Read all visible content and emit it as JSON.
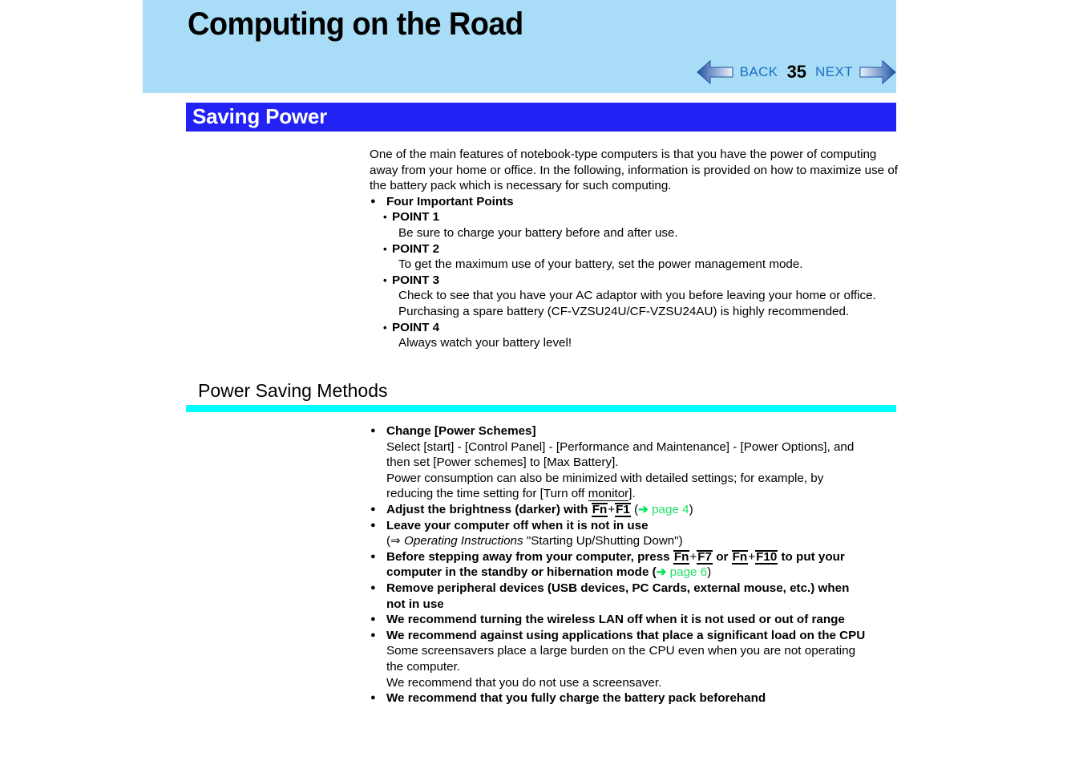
{
  "header": {
    "title": "Computing on the Road",
    "nav": {
      "back_label": "BACK",
      "page_number": "35",
      "next_label": "NEXT",
      "back_icon": "left-arrow-icon",
      "next_icon": "right-arrow-icon"
    },
    "background_color": "#a9ddf7"
  },
  "section": {
    "banner_title": "Saving Power",
    "banner_color": "#2222f5",
    "banner_text_color": "#ffffff"
  },
  "intro": {
    "paragraph": "One of the main features of notebook-type computers is that you have the power of computing away from your home or office.  In the following, information is provided on how to maximize use of the battery pack which is necessary for such computing.",
    "points_heading": "Four Important Points",
    "points": [
      {
        "label": "POINT 1",
        "text": "Be sure to charge your battery before and after use."
      },
      {
        "label": "POINT 2",
        "text": "To get the maximum use of your battery, set the power management mode."
      },
      {
        "label": "POINT 3",
        "text": "Check to see that you have your AC adaptor with you before leaving your home or office.",
        "text2": "Purchasing a spare battery (CF-VZSU24U/CF-VZSU24AU) is highly recommended."
      },
      {
        "label": "POINT 4",
        "text": "Always watch your battery level!"
      }
    ]
  },
  "subsection": {
    "title": "Power Saving Methods",
    "rule_color": "#00ffff"
  },
  "methods": {
    "item1": {
      "heading": "Change [Power Schemes]",
      "line1": "Select [start] - [Control Panel] - [Performance and Maintenance] - [Power Options], and",
      "line2": "then set [Power schemes] to [Max Battery].",
      "line3": "Power consumption can also be minimized with detailed settings; for example, by",
      "line4_pre": "reducing the time setting for [Turn off ",
      "line4_key": "monitor",
      "line4_post": "]."
    },
    "item2": {
      "heading_pre": "Adjust the brightness (darker) with ",
      "key1": "Fn",
      "plus": "+",
      "key2": "F1",
      "link_open": " (",
      "link_arrow": "➔",
      "link_text": " page 4",
      "link_close": ")"
    },
    "item3": {
      "heading": "Leave your computer off when it is not in use",
      "sub_pre": "(⇒ ",
      "sub_italic": "Operating Instructions",
      "sub_post": " \"Starting Up/Shutting Down\")"
    },
    "item4": {
      "pre": "Before stepping away from your computer, press ",
      "key1": "Fn",
      "plus1": "+",
      "key2": "F7",
      "mid": " or ",
      "key3": "Fn",
      "plus2": "+",
      "key4": "F10",
      "post": " to put your",
      "line2_pre": "computer in the standby or hibernation mode (",
      "link_arrow": "➔",
      "link_text": " page 6",
      "link_close": ")"
    },
    "item5": {
      "line1": "Remove peripheral devices (USB devices, PC Cards, external mouse, etc.) when",
      "line2": "not in use"
    },
    "item6": {
      "heading": "We recommend turning the wireless LAN off when it is not used or out of range"
    },
    "item7": {
      "heading": "We recommend against using applications that place a significant load on the CPU",
      "line1": "Some screensavers place a large burden on the CPU even when you are not operating",
      "line2": "the computer.",
      "line3": "We recommend that you do not use a screensaver."
    },
    "item8": {
      "heading": "We recommend that you fully charge the battery pack beforehand"
    }
  }
}
